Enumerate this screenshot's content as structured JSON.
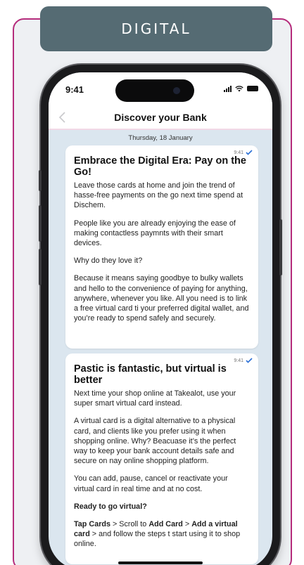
{
  "badge": {
    "label": "DIGITAL"
  },
  "status_bar": {
    "time": "9:41"
  },
  "nav": {
    "title": "Discover your Bank"
  },
  "chat": {
    "date": "Thursday, 18 January",
    "messages": [
      {
        "time": "9:41",
        "title": "Embrace the Digital Era: Pay on the Go!",
        "paragraphs": [
          "Leave those cards at home and join the trend of hasse-free payments on the go next time spend at Dischem.",
          "People like you are already enjoying the ease of making contactless paymnts with their smart devices.",
          "Why do they love it?",
          "Because it means saying goodbye to bulky wallets and hello to the convenience of paying for anything, anywhere, whenever you like. All you need is to link a free virtual card ti your preferred digital wallet, and you’re ready to spend safely and securely."
        ]
      },
      {
        "time": "9:41",
        "title": "Pastic is fantastic, but virtual is better",
        "paragraphs": [
          "Next time your shop online at Takealot, use your super smart virtual card instead.",
          "A virtual card is a digital alternative to a physical card, and clients like you prefer using it when shopping online. Why? Beacuase it’s the perfect way to keep your bank account details safe and secure on nay online shopping platform.",
          "You can add, pause, cancel or reactivate your virtual card in real time and at no cost.",
          "Ready to go virtual?"
        ],
        "steps": {
          "tap_cards": "Tap Cards",
          "sep1": " > Scroll to ",
          "add_card": "Add Card",
          "sep2": " > ",
          "add_virtual": "Add a virtual card",
          "rest": " > and follow the steps t start using it to shop online."
        }
      }
    ]
  },
  "colors": {
    "frame_border": "#b52c7c",
    "badge_bg": "#556b73",
    "check": "#2a6fd6"
  },
  "icons": [
    "back-chevron-icon",
    "signal-icon",
    "wifi-icon",
    "battery-icon",
    "double-check-icon"
  ]
}
